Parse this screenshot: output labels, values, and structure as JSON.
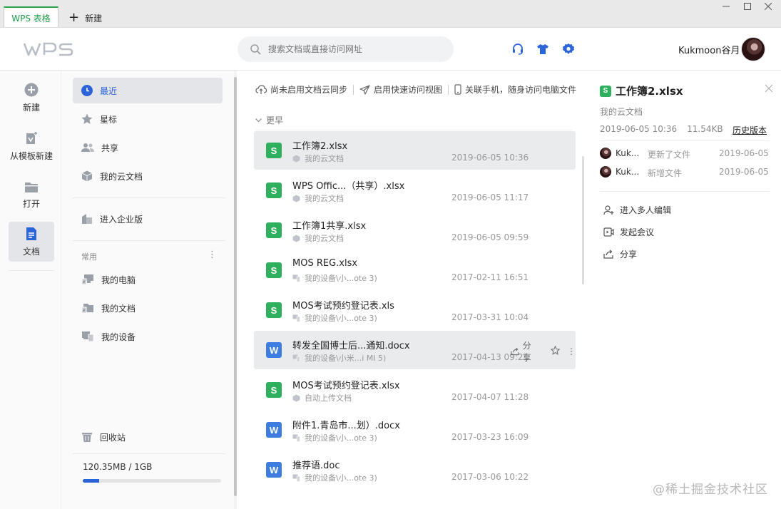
{
  "titlebar": {
    "active_tab": "WPS 表格",
    "new_tab": "新建"
  },
  "header": {
    "logo": "WPS",
    "search_placeholder": "搜索文档或直接访问网址",
    "username": "Kukmoon谷月"
  },
  "rail": {
    "items": [
      {
        "label": "新建",
        "icon": "plus-circle-icon"
      },
      {
        "label": "从模板新建",
        "icon": "template-icon"
      },
      {
        "label": "打开",
        "icon": "folder-icon"
      },
      {
        "label": "文档",
        "icon": "document-icon",
        "active": true
      }
    ]
  },
  "nav": {
    "items": [
      {
        "label": "最近",
        "icon": "clock-icon",
        "active": true
      },
      {
        "label": "星标",
        "icon": "star-icon"
      },
      {
        "label": "共享",
        "icon": "people-icon"
      },
      {
        "label": "我的云文档",
        "icon": "cloud-box-icon"
      }
    ],
    "enterprise": "进入企业版",
    "section_title": "常用",
    "common": [
      {
        "label": "我的电脑",
        "icon": "computer-icon"
      },
      {
        "label": "我的文档",
        "icon": "docs-folder-icon"
      },
      {
        "label": "我的设备",
        "icon": "devices-icon"
      }
    ],
    "recycle": "回收站",
    "storage": "120.35MB / 1GB",
    "storage_used_fraction": 0.1175
  },
  "main": {
    "toolbar": [
      "尚未启用文档云同步",
      "启用快速访问视图",
      "关联手机，随身访问电脑文件"
    ],
    "group": "更早",
    "files": [
      {
        "type": "s",
        "name": "工作簿2.xlsx",
        "loc": "我的云文档",
        "time": "2019-06-05 10:36",
        "highlight": true
      },
      {
        "type": "s",
        "name": "WPS Offic...（共享）.xlsx",
        "loc": "我的云文档",
        "time": "2019-06-05 11:17"
      },
      {
        "type": "s",
        "name": "工作簿1共享.xlsx",
        "loc": "我的云文档",
        "time": "2019-06-05 09:59"
      },
      {
        "type": "s",
        "name": "MOS REG.xlsx",
        "loc": "我的设备\\小...ote 3)",
        "time": "2017-02-11 16:51"
      },
      {
        "type": "s",
        "name": "MOS考试预约登记表.xls",
        "loc": "我的设备\\小...ote 3)",
        "time": "2017-03-31 10:04"
      },
      {
        "type": "w",
        "name": "转发全国博士后...通知.docx",
        "loc": "我的设备\\小米...i MI 5)",
        "time": "2017-04-13 09:21",
        "highlight": true,
        "hover": true
      },
      {
        "type": "s",
        "name": "MOS考试预约登记表.xlsx",
        "loc": "自动上传文档",
        "time": "2017-04-07 11:28"
      },
      {
        "type": "w",
        "name": "附件1.青岛市...划）.docx",
        "loc": "我的设备\\小...ote 3)",
        "time": "2017-03-23 16:09"
      },
      {
        "type": "w",
        "name": "推荐语.doc",
        "loc": "我的设备\\小...ote 3)",
        "time": "2017-03-06 10:22"
      }
    ],
    "share_label": "分享"
  },
  "detail": {
    "icon_letter": "S",
    "title": "工作簿2.xlsx",
    "location": "我的云文档",
    "datetime": "2019-06-05 10:36",
    "size": "11.54KB",
    "history": "历史版本",
    "activity": [
      {
        "user": "Kuk...",
        "action": "更新了文件",
        "date": "2019-06-05"
      },
      {
        "user": "Kuk...",
        "action": "新增文件",
        "date": "2019-06-05"
      }
    ],
    "ops": [
      {
        "label": "进入多人编辑",
        "icon": "add-user-icon"
      },
      {
        "label": "发起会议",
        "icon": "meeting-icon"
      },
      {
        "label": "分享",
        "icon": "share-icon"
      }
    ]
  },
  "watermark": "@稀土掘金技术社区",
  "colors": {
    "accent_blue": "#2b63d9",
    "sheet_green": "#2fb05e",
    "writer_blue": "#3d7de0",
    "tab_green": "#28a64f"
  }
}
